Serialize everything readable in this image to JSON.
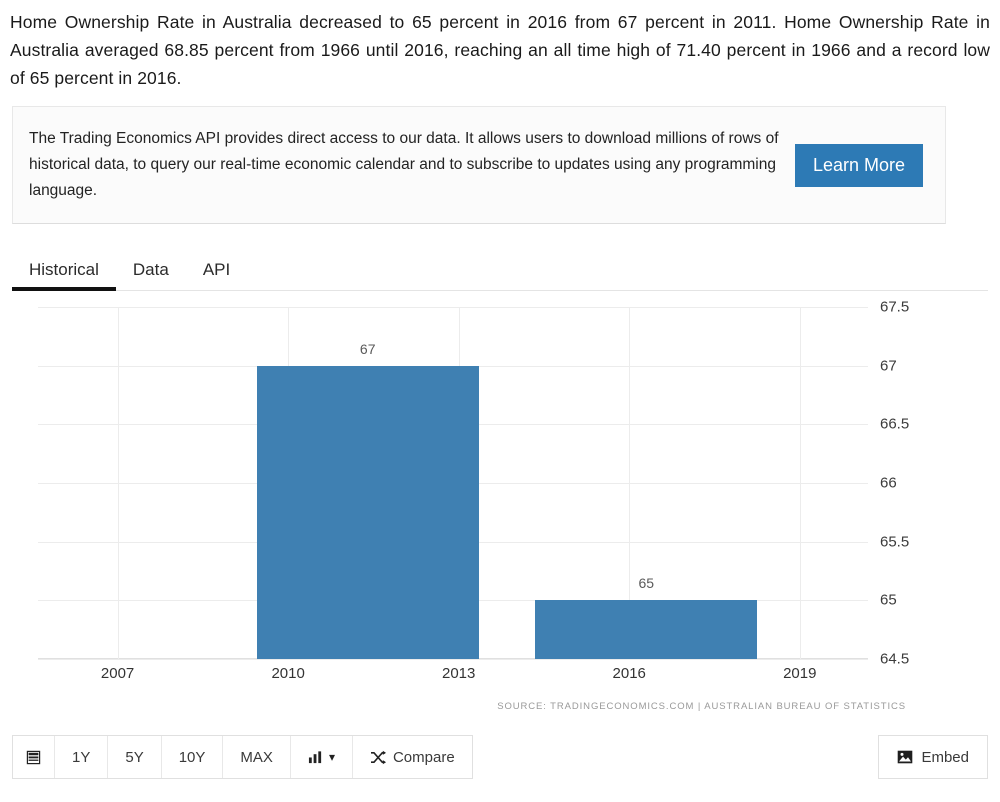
{
  "intro": {
    "paragraph": "Home Ownership Rate in Australia decreased to 65 percent in 2016 from 67 percent in 2011. Home Ownership Rate in Australia averaged 68.85 percent from 1966 until 2016, reaching an all time high of 71.40 percent in 1966 and a record low of 65 percent in 2016."
  },
  "promo": {
    "text": "The Trading Economics API provides direct access to our data. It allows users to download millions of rows of historical data, to query our real-time economic calendar and to subscribe to updates using any programming language.",
    "button_label": "Learn More",
    "button_color": "#2d7ab5"
  },
  "tabs": [
    {
      "label": "Historical",
      "active": true
    },
    {
      "label": "Data",
      "active": false
    },
    {
      "label": "API",
      "active": false
    }
  ],
  "chart_data": {
    "type": "bar",
    "title": "",
    "xlabel": "",
    "ylabel": "",
    "categories": [
      "2011",
      "2016"
    ],
    "values": [
      67,
      65
    ],
    "bar_labels": [
      "67",
      "65"
    ],
    "bar_color": "#3f80b2",
    "ylim": [
      64.5,
      67.5
    ],
    "yticks": [
      "67.5",
      "67",
      "66.5",
      "66",
      "65.5",
      "65",
      "64.5"
    ],
    "ytick_values": [
      67.5,
      67,
      66.5,
      66,
      65.5,
      65,
      64.5
    ],
    "xticks": [
      "2007",
      "2010",
      "2013",
      "2016",
      "2019"
    ],
    "xtick_values": [
      2007,
      2010,
      2013,
      2016,
      2019
    ],
    "xlim": [
      2005.6,
      2020.2
    ],
    "grid": true,
    "legend": false,
    "source": "SOURCE: TRADINGECONOMICS.COM | AUSTRALIAN BUREAU OF STATISTICS"
  },
  "toolbar": {
    "calendar_icon": "calendar-icon",
    "ranges": [
      "1Y",
      "5Y",
      "10Y",
      "MAX"
    ],
    "chart_type_icon": "bar-chart-icon",
    "chart_type_caret": "▾",
    "compare_icon": "shuffle-icon",
    "compare_label": "Compare",
    "embed_icon": "image-icon",
    "embed_label": "Embed"
  }
}
